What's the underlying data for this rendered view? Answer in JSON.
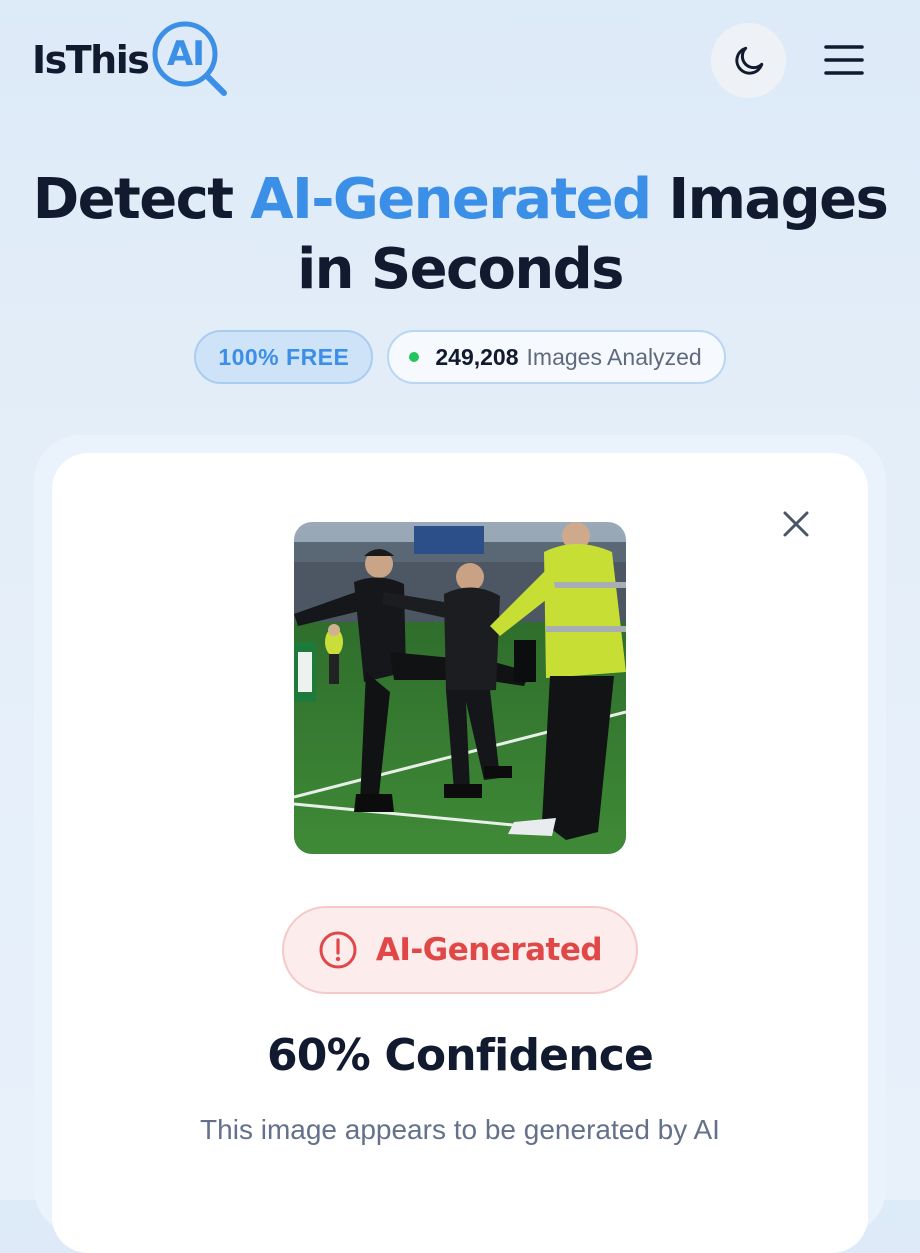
{
  "header": {
    "logo_text": "IsThis",
    "logo_badge": "AI",
    "theme_icon": "moon-icon",
    "menu_icon": "hamburger-menu-icon"
  },
  "hero": {
    "title_pre": "Detect ",
    "title_accent": "AI-Generated",
    "title_post": " Images",
    "title_line2": "in Seconds",
    "free_badge": "100% FREE",
    "images_count": "249,208",
    "images_label": "Images Analyzed"
  },
  "result": {
    "close_icon": "close-icon",
    "preview_alt": "Uploaded photo",
    "status_icon": "alert-circle-icon",
    "verdict": "AI-Generated",
    "confidence": "60% Confidence",
    "description": "This image appears to be generated by AI"
  },
  "colors": {
    "accent": "#3b8fe6",
    "verdict_red": "#e04848",
    "live_dot": "#22c55e"
  }
}
